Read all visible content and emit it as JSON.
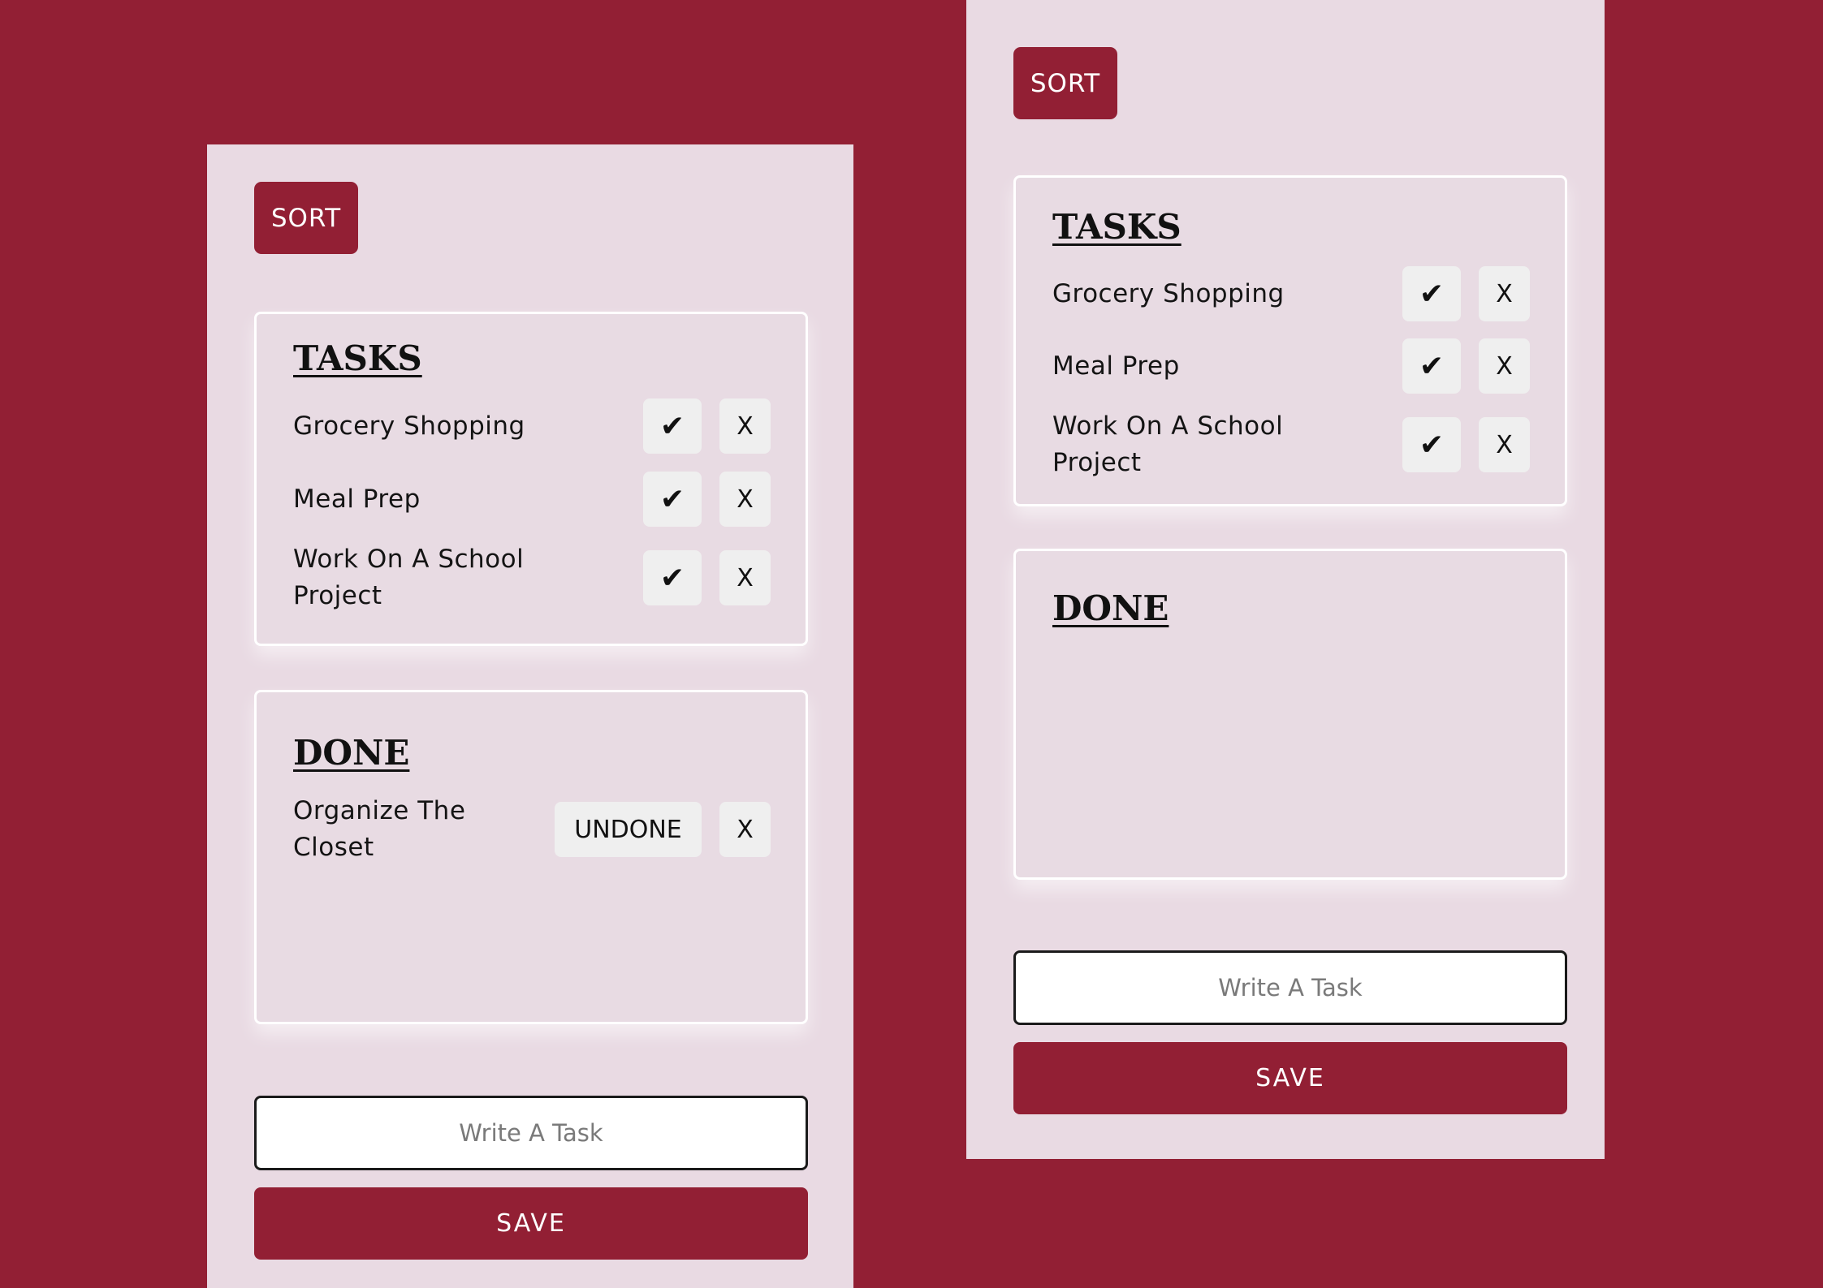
{
  "colors": {
    "background": "#921f34",
    "panel": "#e9dae3",
    "accent": "#921f34",
    "button": "#efefef"
  },
  "left_view": {
    "sort_label": "SORT",
    "tasks_title": "TASKS",
    "tasks": [
      {
        "label": "Grocery Shopping",
        "check": "✔",
        "delete": "X"
      },
      {
        "label": "Meal Prep",
        "check": "✔",
        "delete": "X"
      },
      {
        "label": "Work On A School Project",
        "check": "✔",
        "delete": "X"
      }
    ],
    "done_title": "DONE",
    "done": [
      {
        "label": "Organize The Closet",
        "undone": "UNDONE",
        "delete": "X"
      }
    ],
    "input_placeholder": "Write A Task",
    "save_label": "SAVE"
  },
  "right_view": {
    "sort_label": "SORT",
    "tasks_title": "TASKS",
    "tasks": [
      {
        "label": "Grocery Shopping",
        "check": "✔",
        "delete": "X"
      },
      {
        "label": "Meal Prep",
        "check": "✔",
        "delete": "X"
      },
      {
        "label": "Work On A School Project",
        "check": "✔",
        "delete": "X"
      }
    ],
    "done_title": "DONE",
    "done": [],
    "input_placeholder": "Write A Task",
    "save_label": "SAVE"
  }
}
